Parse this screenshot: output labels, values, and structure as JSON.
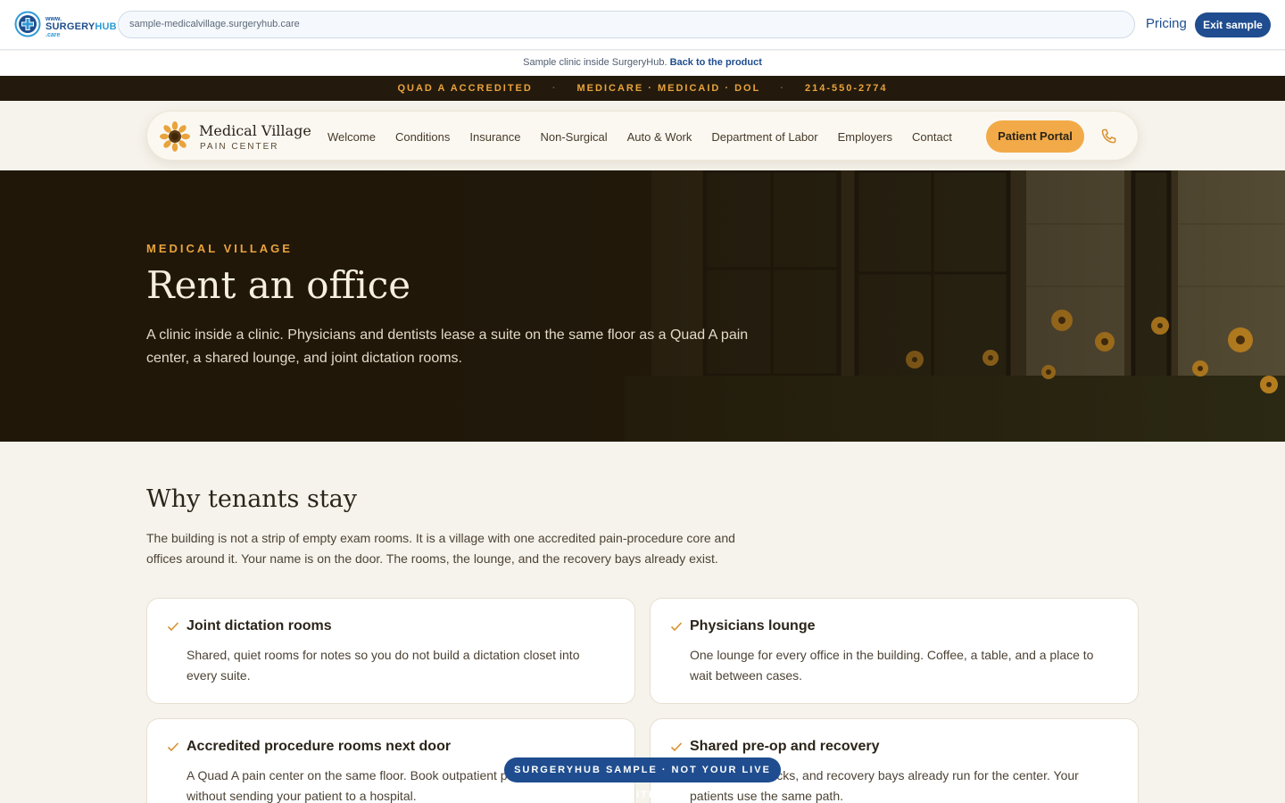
{
  "surgeryhub": {
    "logo_www": "www.",
    "logo_name_a": "SURGERY",
    "logo_name_b": "HUB",
    "logo_tld": ".care",
    "url": "sample-medicalvillage.surgeryhub.care",
    "pricing_label": "Pricing",
    "exit_label": "Exit sample",
    "notice_text": "Sample clinic inside SurgeryHub.",
    "notice_link": "Back to the product",
    "sample_badge": "SURGERYHUB SAMPLE · NOT YOUR LIVE SITE",
    "brand_color": "#1f4d8f"
  },
  "strip": {
    "items": [
      "QUAD A ACCREDITED",
      "MEDICARE · MEDICAID · DOL",
      "214-550-2774"
    ],
    "separator": "·"
  },
  "clinic_nav": {
    "brand_name": "Medical Village",
    "brand_sub": "PAIN CENTER",
    "brand_icon": "sunflower-icon",
    "links": [
      "Welcome",
      "Conditions",
      "Insurance",
      "Non-Surgical",
      "Auto & Work",
      "Department of Labor",
      "Employers",
      "Contact"
    ],
    "portal_label": "Patient Portal",
    "phone_icon": "phone-icon",
    "accent_color": "#f2aa48"
  },
  "hero": {
    "eyebrow": "MEDICAL VILLAGE",
    "title": "Rent an office",
    "text": "A clinic inside a clinic. Physicians and dentists lease a suite on the same floor as a Quad A pain center, a shared lounge, and joint dictation rooms."
  },
  "why": {
    "title": "Why tenants stay",
    "text": "The building is not a strip of empty exam rooms. It is a village with one accredited pain-procedure core and offices around it. Your name is on the door. The rooms, the lounge, and the recovery bays already exist.",
    "cards": [
      {
        "title": "Joint dictation rooms",
        "text": "Shared, quiet rooms for notes so you do not build a dictation closet into every suite."
      },
      {
        "title": "Physicians lounge",
        "text": "One lounge for every office in the building. Coffee, a table, and a place to wait between cases."
      },
      {
        "title": "Accredited procedure rooms next door",
        "text": "A Quad A pain center on the same floor. Book outpatient pain procedures without sending your patient to a hospital."
      },
      {
        "title": "Shared pre-op and recovery",
        "text": "Intake, vital checks, and recovery bays already run for the center. Your patients use the same path."
      }
    ]
  }
}
